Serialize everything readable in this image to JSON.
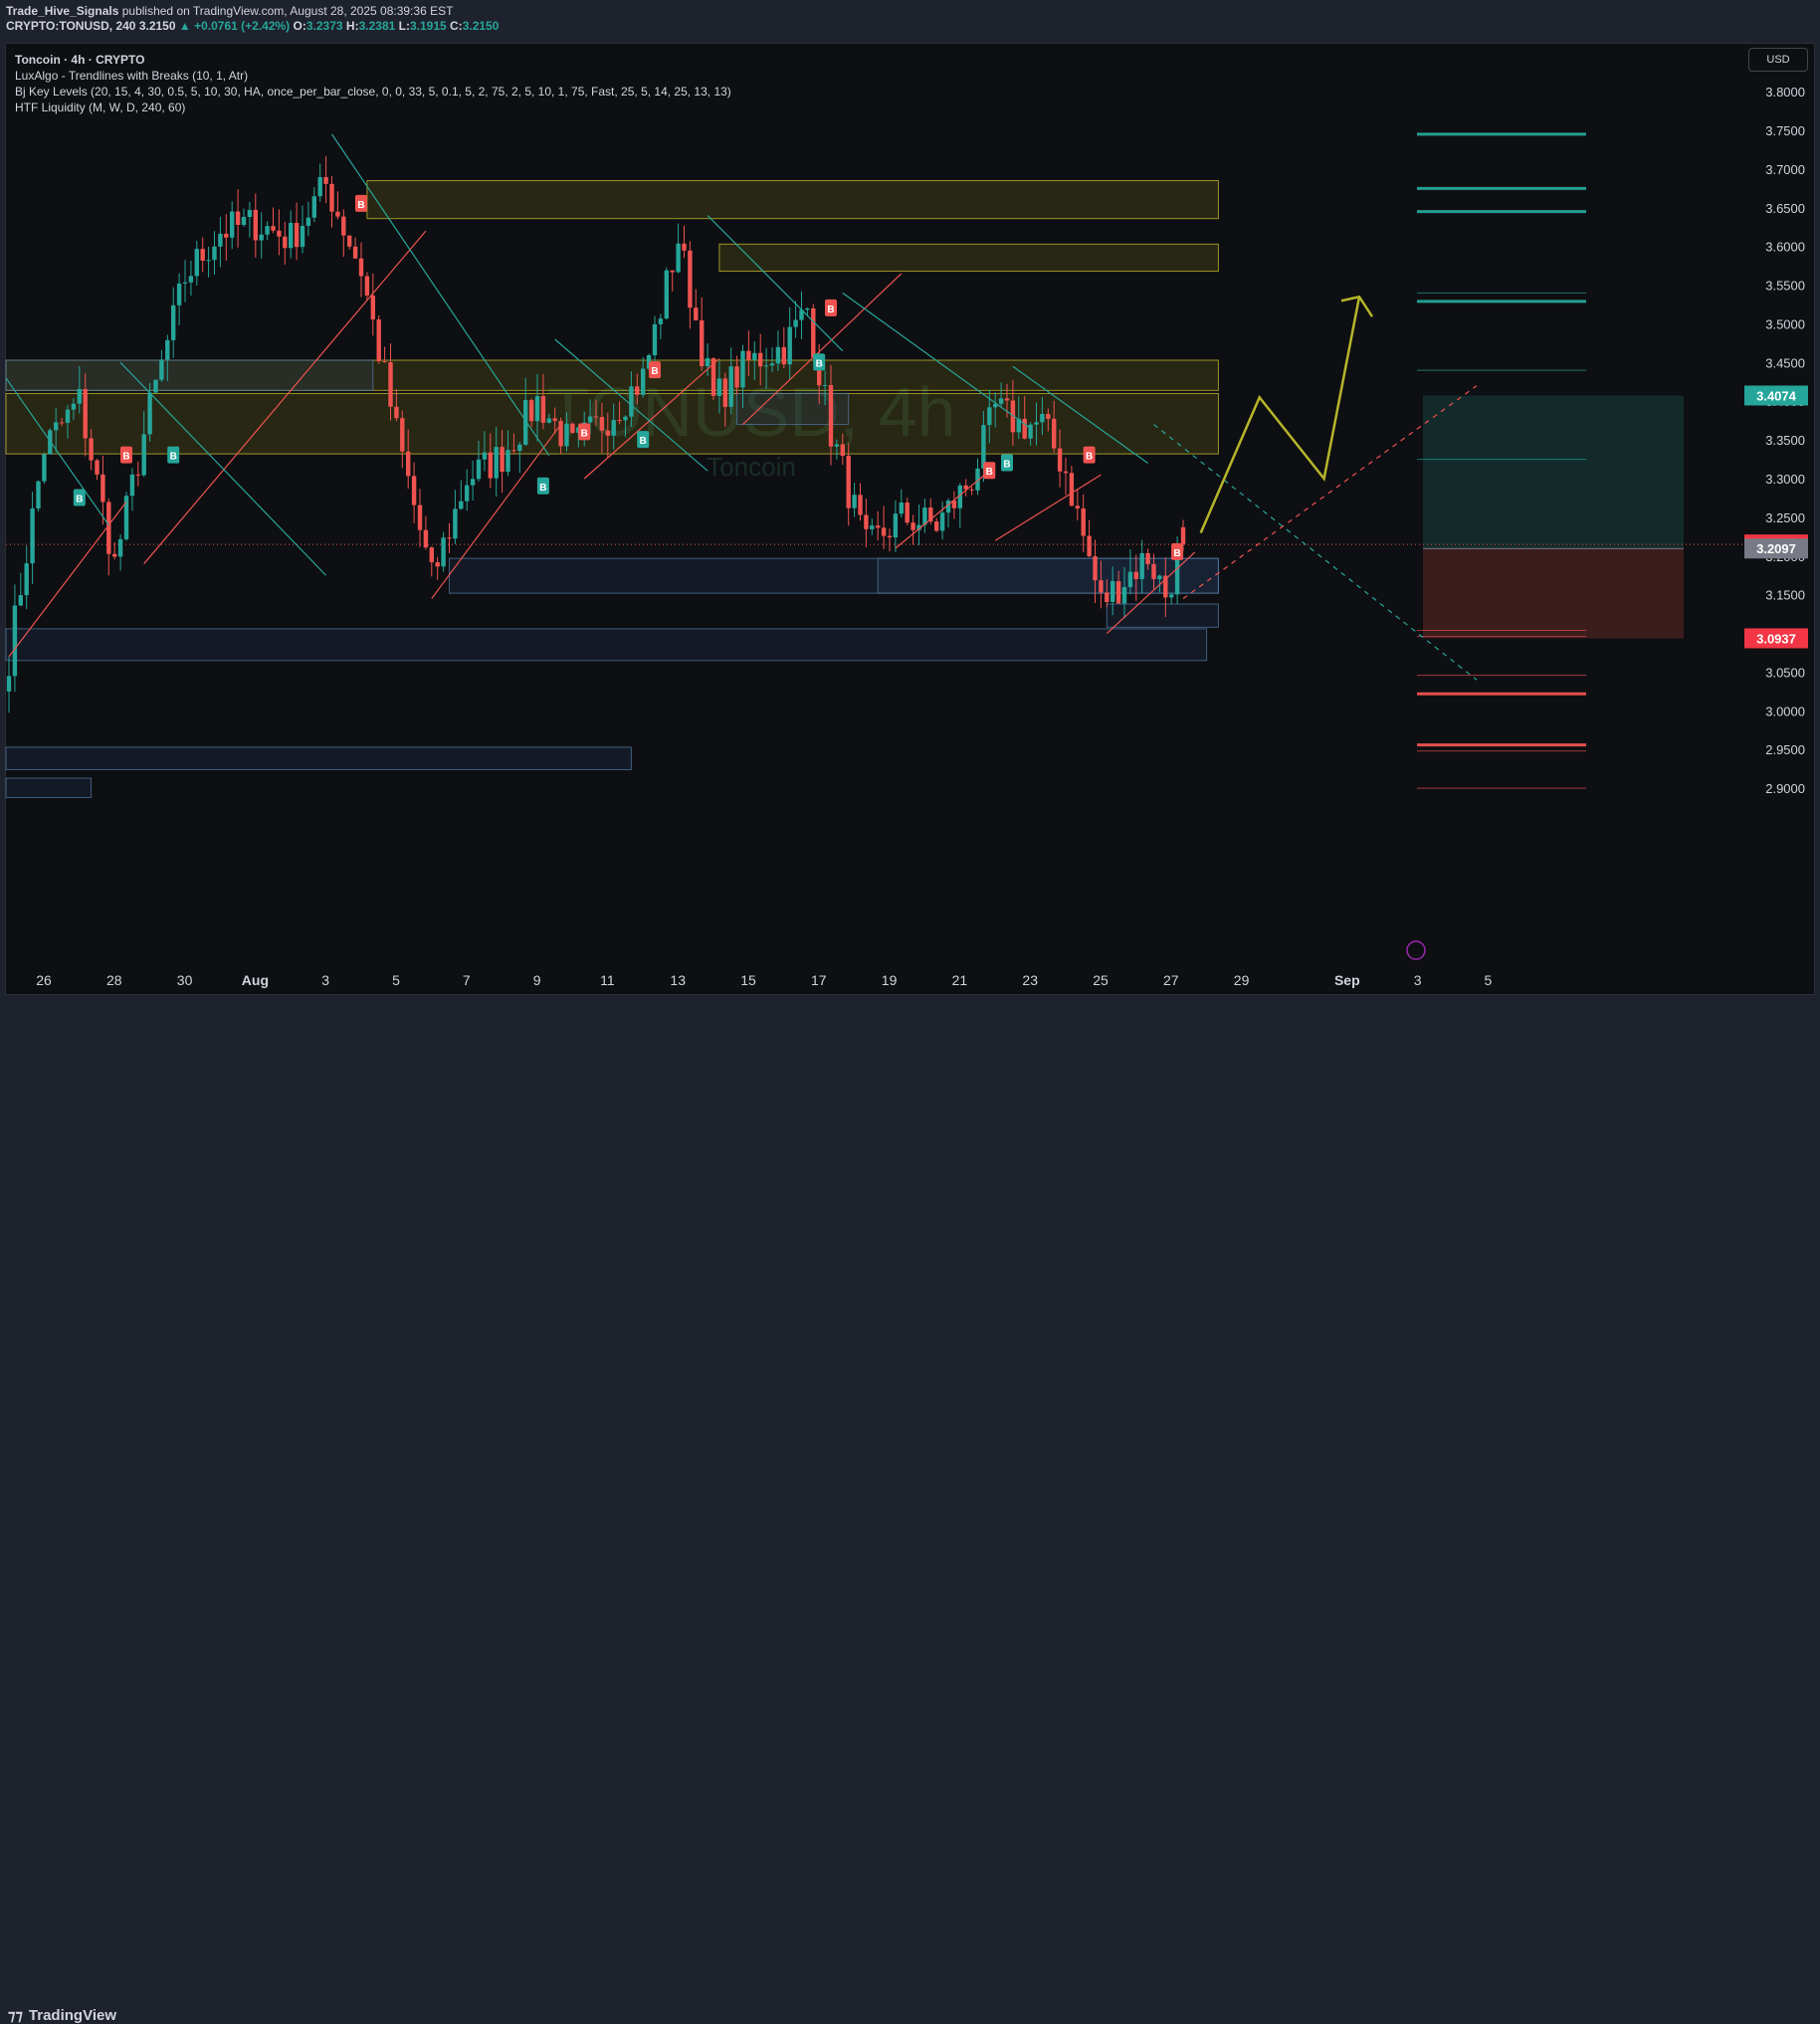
{
  "header": {
    "author": "Trade_Hive_Signals",
    "published": "published on TradingView.com, August 28, 2025 08:39:36 EST",
    "ticker": "CRYPTO:TONUSD, 240",
    "last": "3.2150",
    "arrow": "▲",
    "change": "+0.0761 (+2.42%)",
    "o_label": "O:",
    "o": "3.2373",
    "h_label": "H:",
    "h": "3.2381",
    "l_label": "L:",
    "l": "3.1915",
    "c_label": "C:",
    "c": "3.2150"
  },
  "legend": {
    "symbol": "Toncoin · 4h · CRYPTO",
    "ind1": "LuxAlgo - Trendlines with Breaks (10, 1, Atr)",
    "ind2": "Bj Key Levels (20, 15, 4, 30, 0.5, 5, 10, 30, HA, once_per_bar_close, 0, 0, 33, 5, 0.1, 5, 2, 75, 2, 5, 10, 1, 75, Fast, 25, 5, 14, 25, 13, 13)",
    "ind3": "HTF Liquidity (M, W, D, 240, 60)"
  },
  "currency": "USD",
  "watermark": {
    "symbol": "TONUSD, 4h",
    "name": "Toncoin"
  },
  "footer": {
    "brand": "TradingView"
  },
  "colors": {
    "bull": "#26a69a",
    "bear": "#ef5350",
    "zone_yellow": "#e6d13a",
    "zone_blue": "#4a6a8a",
    "target": "#26a69a",
    "stop": "#ef5350",
    "projection": "#b5b52a"
  },
  "chart_data": {
    "type": "candlestick",
    "timeframe": "4h",
    "y_axis": {
      "ticks": [
        "3.8000",
        "3.7500",
        "3.7000",
        "3.6500",
        "3.6000",
        "3.5500",
        "3.5000",
        "3.4500",
        "3.4000",
        "3.3500",
        "3.3000",
        "3.2500",
        "3.2000",
        "3.1500",
        "3.1000",
        "3.0500",
        "3.0000",
        "2.9500",
        "2.9000"
      ],
      "range": [
        2.88,
        3.84
      ]
    },
    "x_axis": {
      "ticks": [
        {
          "label": "26",
          "i": 0
        },
        {
          "label": "28",
          "i": 12
        },
        {
          "label": "30",
          "i": 24
        },
        {
          "label": "Aug",
          "i": 36
        },
        {
          "label": "3",
          "i": 48
        },
        {
          "label": "5",
          "i": 60
        },
        {
          "label": "7",
          "i": 72
        },
        {
          "label": "9",
          "i": 84
        },
        {
          "label": "11",
          "i": 96
        },
        {
          "label": "13",
          "i": 108
        },
        {
          "label": "15",
          "i": 120
        },
        {
          "label": "17",
          "i": 132
        },
        {
          "label": "19",
          "i": 144
        },
        {
          "label": "21",
          "i": 156
        },
        {
          "label": "23",
          "i": 168
        },
        {
          "label": "25",
          "i": 180
        },
        {
          "label": "27",
          "i": 192
        },
        {
          "label": "29",
          "i": 204
        },
        {
          "label": "Sep",
          "i": 222
        },
        {
          "label": "3",
          "i": 234
        },
        {
          "label": "5",
          "i": 246
        }
      ],
      "start": "Jul 25",
      "bar_hours": 4
    },
    "price_labels": [
      {
        "label": "3.4074",
        "value": 3.4074,
        "color": "#26a69a"
      },
      {
        "label": "3.2150",
        "value": 3.215,
        "color": "#f23645"
      },
      {
        "label": "3.2097",
        "value": 3.2097,
        "color": "#787b86"
      },
      {
        "label": "3.0937",
        "value": 3.0937,
        "color": "#f23645"
      }
    ],
    "position": {
      "entry": 3.2097,
      "target": 3.4074,
      "stop": 3.0937
    },
    "key_points": [
      {
        "i": 0,
        "c": 3.07
      },
      {
        "i": 6,
        "c": 3.34
      },
      {
        "i": 12,
        "c": 3.4
      },
      {
        "i": 18,
        "c": 3.19
      },
      {
        "i": 24,
        "c": 3.39
      },
      {
        "i": 30,
        "c": 3.56
      },
      {
        "i": 36,
        "c": 3.62
      },
      {
        "i": 42,
        "c": 3.63
      },
      {
        "i": 48,
        "c": 3.61
      },
      {
        "i": 54,
        "c": 3.68
      },
      {
        "i": 60,
        "c": 3.57
      },
      {
        "i": 66,
        "c": 3.36
      },
      {
        "i": 72,
        "c": 3.17
      },
      {
        "i": 78,
        "c": 3.3
      },
      {
        "i": 84,
        "c": 3.33
      },
      {
        "i": 90,
        "c": 3.4
      },
      {
        "i": 96,
        "c": 3.34
      },
      {
        "i": 102,
        "c": 3.38
      },
      {
        "i": 108,
        "c": 3.43
      },
      {
        "i": 114,
        "c": 3.61
      },
      {
        "i": 120,
        "c": 3.4
      },
      {
        "i": 126,
        "c": 3.45
      },
      {
        "i": 132,
        "c": 3.47
      },
      {
        "i": 136,
        "c": 3.52
      },
      {
        "i": 140,
        "c": 3.36
      },
      {
        "i": 146,
        "c": 3.21
      },
      {
        "i": 152,
        "c": 3.25
      },
      {
        "i": 158,
        "c": 3.24
      },
      {
        "i": 164,
        "c": 3.3
      },
      {
        "i": 168,
        "c": 3.39
      },
      {
        "i": 172,
        "c": 3.37
      },
      {
        "i": 176,
        "c": 3.37
      },
      {
        "i": 180,
        "c": 3.31
      },
      {
        "i": 186,
        "c": 3.14
      },
      {
        "i": 190,
        "c": 3.17
      },
      {
        "i": 194,
        "c": 3.2
      },
      {
        "i": 197,
        "c": 3.15
      },
      {
        "i": 200,
        "c": 3.215
      }
    ],
    "signals": [
      {
        "type": "B",
        "i": 12,
        "p": 3.275,
        "color": "#26a69a"
      },
      {
        "type": "B",
        "i": 20,
        "p": 3.33,
        "color": "#ef5350"
      },
      {
        "type": "B",
        "i": 28,
        "p": 3.33,
        "color": "#26a69a"
      },
      {
        "type": "B",
        "i": 60,
        "p": 3.655,
        "color": "#ef5350"
      },
      {
        "type": "B",
        "i": 91,
        "p": 3.29,
        "color": "#26a69a"
      },
      {
        "type": "B",
        "i": 98,
        "p": 3.36,
        "color": "#ef5350"
      },
      {
        "type": "B",
        "i": 108,
        "p": 3.35,
        "color": "#26a69a"
      },
      {
        "type": "B",
        "i": 110,
        "p": 3.44,
        "color": "#ef5350"
      },
      {
        "type": "B",
        "i": 138,
        "p": 3.45,
        "color": "#26a69a"
      },
      {
        "type": "B",
        "i": 140,
        "p": 3.52,
        "color": "#ef5350"
      },
      {
        "type": "B",
        "i": 167,
        "p": 3.31,
        "color": "#ef5350"
      },
      {
        "type": "B",
        "i": 170,
        "p": 3.32,
        "color": "#26a69a"
      },
      {
        "type": "B",
        "i": 184,
        "p": 3.33,
        "color": "#ef5350"
      },
      {
        "type": "B",
        "i": 199,
        "p": 3.205,
        "color": "#ef5350"
      }
    ],
    "zones": [
      {
        "kind": "supply",
        "i0": 61,
        "i1": 206,
        "p_hi": 3.685,
        "p_lo": 3.636
      },
      {
        "kind": "supply",
        "i0": 121,
        "i1": 206,
        "p_hi": 3.603,
        "p_lo": 3.568
      },
      {
        "kind": "supply",
        "i0": -1,
        "i1": 206,
        "p_hi": 3.453,
        "p_lo": 3.414
      },
      {
        "kind": "supply",
        "i0": -1,
        "i1": 206,
        "p_hi": 3.41,
        "p_lo": 3.332
      },
      {
        "kind": "demand",
        "i0": -1,
        "i1": 62,
        "p_hi": 3.453,
        "p_lo": 3.414
      },
      {
        "kind": "demand",
        "i0": 124,
        "i1": 143,
        "p_hi": 3.41,
        "p_lo": 3.37
      },
      {
        "kind": "demand",
        "i0": 75,
        "i1": 206,
        "p_hi": 3.197,
        "p_lo": 3.152
      },
      {
        "kind": "demand",
        "i0": 148,
        "i1": 206,
        "p_hi": 3.197,
        "p_lo": 3.152
      },
      {
        "kind": "demand",
        "i0": 187,
        "i1": 206,
        "p_hi": 3.138,
        "p_lo": 3.108
      },
      {
        "kind": "demand",
        "i0": -1,
        "i1": 204,
        "p_hi": 3.106,
        "p_lo": 3.065
      },
      {
        "kind": "demand",
        "i0": -1,
        "i1": 106,
        "p_hi": 2.953,
        "p_lo": 2.924
      },
      {
        "kind": "demand",
        "i0": -1,
        "i1": 14,
        "p_hi": 2.913,
        "p_lo": 2.888
      }
    ],
    "liquidity_levels": [
      {
        "p": 3.745,
        "color": "#26a69a",
        "w": 3
      },
      {
        "p": 3.675,
        "color": "#26a69a",
        "w": 3
      },
      {
        "p": 3.645,
        "color": "#26a69a",
        "w": 3
      },
      {
        "p": 3.54,
        "color": "#26a69a",
        "w": 1
      },
      {
        "p": 3.529,
        "color": "#26a69a",
        "w": 3
      },
      {
        "p": 3.44,
        "color": "#26a69a",
        "w": 1
      },
      {
        "p": 3.325,
        "color": "#26a69a",
        "w": 1
      },
      {
        "p": 3.104,
        "color": "#ef5350",
        "w": 1
      },
      {
        "p": 3.096,
        "color": "#ef5350",
        "w": 1
      },
      {
        "p": 3.046,
        "color": "#ef5350",
        "w": 1
      },
      {
        "p": 3.022,
        "color": "#ef5350",
        "w": 3
      },
      {
        "p": 2.956,
        "color": "#ef5350",
        "w": 3
      },
      {
        "p": 2.948,
        "color": "#ef5350",
        "w": 1
      },
      {
        "p": 2.9,
        "color": "#ef5350",
        "w": 1
      }
    ],
    "trendlines": [
      {
        "i0": 0,
        "p0": 3.07,
        "i1": 20,
        "p1": 3.27,
        "color": "#ef5350"
      },
      {
        "i0": 23,
        "p0": 3.19,
        "i1": 71,
        "p1": 3.62,
        "color": "#ef5350"
      },
      {
        "i0": 72,
        "p0": 3.145,
        "i1": 94,
        "p1": 3.37,
        "color": "#ef5350"
      },
      {
        "i0": 98,
        "p0": 3.3,
        "i1": 121,
        "p1": 3.455,
        "color": "#ef5350"
      },
      {
        "i0": 125,
        "p0": 3.37,
        "i1": 152,
        "p1": 3.565,
        "color": "#ef5350"
      },
      {
        "i0": 151,
        "p0": 3.21,
        "i1": 167,
        "p1": 3.31,
        "color": "#ef5350"
      },
      {
        "i0": 168,
        "p0": 3.22,
        "i1": 186,
        "p1": 3.305,
        "color": "#ef5350"
      },
      {
        "i0": 187,
        "p0": 3.1,
        "i1": 202,
        "p1": 3.205,
        "color": "#ef5350"
      },
      {
        "i0": -1,
        "p0": 3.43,
        "i1": 17,
        "p1": 3.24,
        "color": "#26a69a"
      },
      {
        "i0": 19,
        "p0": 3.45,
        "i1": 54,
        "p1": 3.175,
        "color": "#26a69a"
      },
      {
        "i0": 55,
        "p0": 3.745,
        "i1": 92,
        "p1": 3.33,
        "color": "#26a69a"
      },
      {
        "i0": 93,
        "p0": 3.48,
        "i1": 119,
        "p1": 3.31,
        "color": "#26a69a"
      },
      {
        "i0": 119,
        "p0": 3.64,
        "i1": 142,
        "p1": 3.465,
        "color": "#26a69a"
      },
      {
        "i0": 142,
        "p0": 3.54,
        "i1": 174,
        "p1": 3.365,
        "color": "#26a69a"
      },
      {
        "i0": 171,
        "p0": 3.445,
        "i1": 194,
        "p1": 3.32,
        "color": "#26a69a"
      }
    ],
    "projection_dashed": [
      {
        "i0": 200,
        "p0": 3.145,
        "i1": 250,
        "p1": 3.42,
        "color": "#ef5350"
      },
      {
        "i0": 195,
        "p0": 3.37,
        "i1": 250,
        "p1": 3.04,
        "color": "#26a69a"
      }
    ],
    "projection_path": [
      {
        "i": 203,
        "p": 3.23
      },
      {
        "i": 213,
        "p": 3.405
      },
      {
        "i": 224,
        "p": 3.3
      },
      {
        "i": 230,
        "p": 3.535
      }
    ]
  }
}
